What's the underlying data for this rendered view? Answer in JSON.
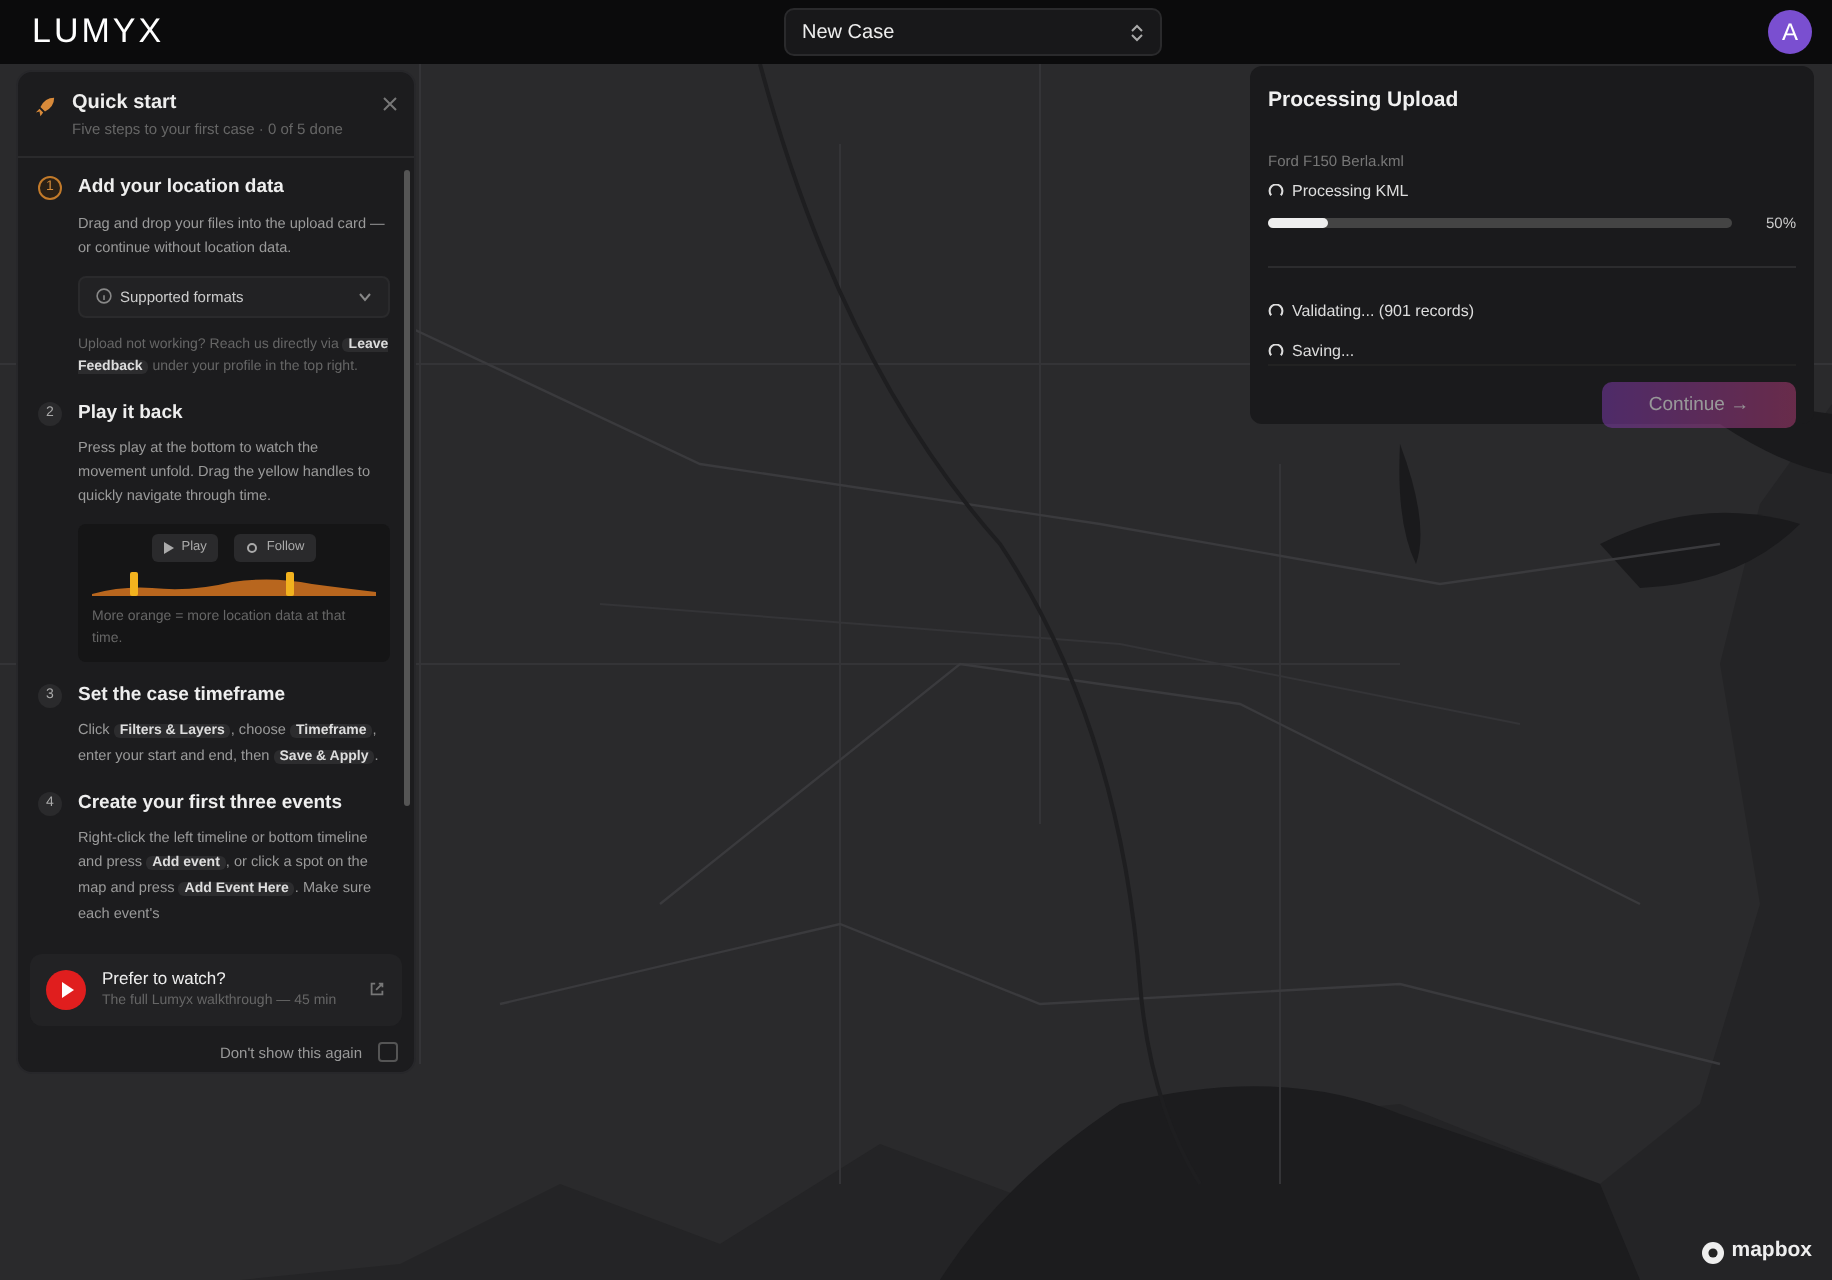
{
  "topbar": {
    "logo": "LUMYX",
    "case_select": {
      "value": "New Case"
    },
    "avatar": "A"
  },
  "quick_start": {
    "title": "Quick start",
    "subtitle": "Five steps to your first case · 0 of 5 done",
    "steps": [
      {
        "number": "1",
        "current": true,
        "title": "Add your location data",
        "body": [
          {
            "kind": "text",
            "text": "Drag and drop your files into the upload card — or continue without location data."
          }
        ],
        "disclosure": {
          "label": "Supported formats",
          "expanded": false
        },
        "note": [
          {
            "kind": "text",
            "text": "Upload not working? Reach us directly via "
          },
          {
            "kind": "key",
            "text": "Leave Feedback"
          },
          {
            "kind": "text",
            "text": " under your profile in the top right."
          }
        ]
      },
      {
        "number": "2",
        "current": false,
        "title": "Play it back",
        "body": [
          {
            "kind": "text",
            "text": "Press play at the bottom to watch the movement unfold. Drag the yellow handles to quickly navigate through time."
          }
        ],
        "preview": {
          "buttons": [
            "Play",
            "Follow"
          ],
          "caption": "More orange = more location data at that time."
        }
      },
      {
        "number": "3",
        "current": false,
        "title": "Set the case timeframe",
        "body": [
          {
            "kind": "text",
            "text": "Click "
          },
          {
            "kind": "key",
            "text": "Filters & Layers"
          },
          {
            "kind": "text",
            "text": ", choose "
          },
          {
            "kind": "key",
            "text": "Timeframe"
          },
          {
            "kind": "text",
            "text": ", enter your start and end, then "
          },
          {
            "kind": "key",
            "text": "Save & Apply"
          },
          {
            "kind": "text",
            "text": "."
          }
        ]
      },
      {
        "number": "4",
        "current": false,
        "title": "Create your first three events",
        "body": [
          {
            "kind": "text",
            "text": "Right-click the left timeline or bottom timeline and press "
          },
          {
            "kind": "key",
            "text": "Add event"
          },
          {
            "kind": "text",
            "text": ", or click a spot on the map and press "
          },
          {
            "kind": "key",
            "text": "Add Event Here"
          },
          {
            "kind": "text",
            "text": ". Make sure each event's"
          }
        ]
      }
    ],
    "video": {
      "title": "Prefer to watch?",
      "subtitle": "The full Lumyx walkthrough — 45 min"
    },
    "dont_show": {
      "label": "Don't show this again",
      "checked": false
    }
  },
  "upload": {
    "title": "Processing Upload",
    "file": "Ford F150 Berla.kml",
    "stage": "Processing KML",
    "level": 0.13,
    "percent": "50%",
    "tasks": [
      "Validating... (901 records)",
      "Saving..."
    ],
    "continue": {
      "label": "Continue →",
      "disabled": true
    }
  },
  "attribution": "mapbox"
}
